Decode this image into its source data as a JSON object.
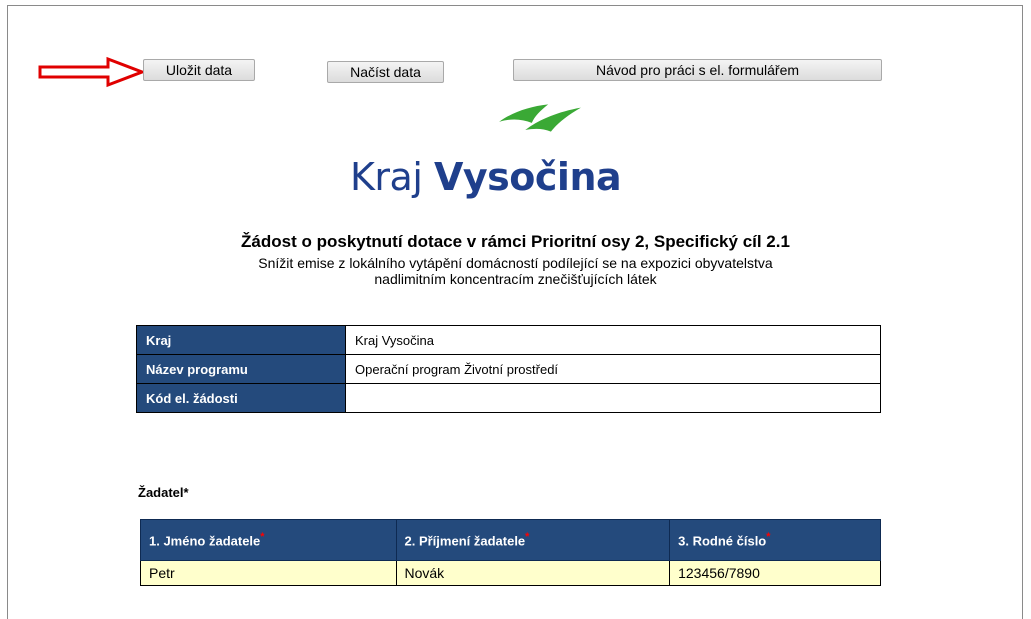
{
  "toolbar": {
    "save_label": "Uložit data",
    "load_label": "Načíst data",
    "guide_label": "Návod pro práci s el. formulářem"
  },
  "logo": {
    "word1": "Kraj",
    "word2": "Vysočina"
  },
  "header": {
    "title": "Žádost o poskytnutí dotace v rámci Prioritní osy 2, Specifický cíl 2.1",
    "subtitle_line1": "Snížit emise z lokálního vytápění domácností podílející se na expozici obyvatelstva",
    "subtitle_line2": "nadlimitním koncentracím znečišťujících látek"
  },
  "info_table": {
    "rows": [
      {
        "label": "Kraj",
        "value": "Kraj Vysočina"
      },
      {
        "label": "Název programu",
        "value": "Operační program Životní prostředí"
      },
      {
        "label": "Kód el. žádosti",
        "value": ""
      }
    ]
  },
  "applicant": {
    "section_label": "Žadatel*",
    "columns": [
      "1. Jméno žadatele",
      "2. Příjmení žadatele",
      "3. Rodné číslo"
    ],
    "required_mark": "*",
    "values": [
      "Petr",
      "Novák",
      "123456/7890"
    ]
  },
  "colors": {
    "header_blue": "#244a7c",
    "field_yellow": "#ffffcc",
    "arrow_red": "#e00000",
    "logo_green": "#3aa935",
    "logo_blue": "#1f3f8c"
  }
}
